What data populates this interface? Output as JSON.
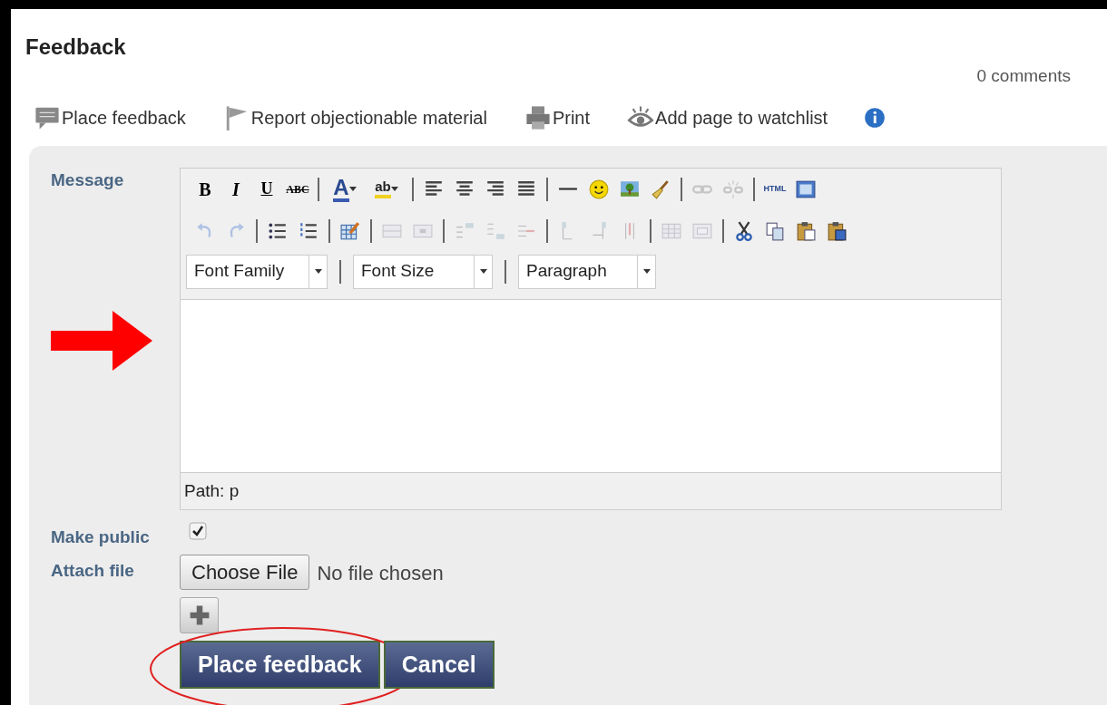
{
  "title": "Feedback",
  "comment_count": "0 comments",
  "actions": [
    {
      "kind": "speech",
      "label": "Place feedback"
    },
    {
      "kind": "flag",
      "label": "Report objectionable material"
    },
    {
      "kind": "printer",
      "label": "Print"
    },
    {
      "kind": "eye",
      "label": "Add page to watchlist"
    },
    {
      "kind": "info"
    }
  ],
  "form": {
    "message_label": "Message",
    "editor": {
      "toolbar_rows": [
        [
          {
            "kind": "bold",
            "label": "B",
            "disabled": false
          },
          {
            "kind": "italic",
            "label": "I",
            "disabled": false
          },
          {
            "kind": "underline",
            "label": "U",
            "disabled": false
          },
          {
            "kind": "strike",
            "label": "ABC",
            "disabled": false
          },
          {
            "kind": "separator"
          },
          {
            "kind": "forecolor",
            "label": "A",
            "disabled": false
          },
          {
            "kind": "backcolor",
            "label": "ab",
            "disabled": false
          },
          {
            "kind": "separator"
          },
          {
            "kind": "alignleft",
            "disabled": false
          },
          {
            "kind": "aligncenter",
            "disabled": false
          },
          {
            "kind": "alignright",
            "disabled": false
          },
          {
            "kind": "justify",
            "disabled": false
          },
          {
            "kind": "separator"
          },
          {
            "kind": "hr",
            "disabled": false
          },
          {
            "kind": "emoticon",
            "disabled": false
          },
          {
            "kind": "image",
            "disabled": false
          },
          {
            "kind": "cleanup",
            "disabled": false
          },
          {
            "kind": "separator"
          },
          {
            "kind": "link",
            "disabled": true
          },
          {
            "kind": "unlink",
            "disabled": true
          },
          {
            "kind": "separator"
          },
          {
            "kind": "html",
            "label": "HTML",
            "disabled": false
          },
          {
            "kind": "fullscreen",
            "disabled": false
          }
        ],
        [
          {
            "kind": "undo",
            "disabled": true
          },
          {
            "kind": "redo",
            "disabled": true
          },
          {
            "kind": "separator"
          },
          {
            "kind": "bullist",
            "disabled": false
          },
          {
            "kind": "numlist",
            "disabled": false
          },
          {
            "kind": "separator"
          },
          {
            "kind": "tableedit",
            "disabled": false
          },
          {
            "kind": "separator"
          },
          {
            "kind": "rowprops",
            "disabled": true
          },
          {
            "kind": "cellprops",
            "disabled": true
          },
          {
            "kind": "separator"
          },
          {
            "kind": "rowbefore",
            "disabled": true
          },
          {
            "kind": "rowafter",
            "disabled": true
          },
          {
            "kind": "deleterow",
            "disabled": true
          },
          {
            "kind": "separator"
          },
          {
            "kind": "colbefore",
            "disabled": true
          },
          {
            "kind": "colafter",
            "disabled": true
          },
          {
            "kind": "deletecol",
            "disabled": true
          },
          {
            "kind": "separator"
          },
          {
            "kind": "split",
            "disabled": true
          },
          {
            "kind": "merge",
            "disabled": true
          },
          {
            "kind": "separator"
          },
          {
            "kind": "cut",
            "disabled": false
          },
          {
            "kind": "copy",
            "disabled": false
          },
          {
            "kind": "paste",
            "disabled": false
          },
          {
            "kind": "pasteword",
            "disabled": false
          }
        ]
      ],
      "dropdowns": [
        {
          "value": "Font Family"
        },
        {
          "value": "Font Size"
        },
        {
          "value": "Paragraph"
        }
      ],
      "path": "Path: p"
    },
    "make_public": {
      "label": "Make public",
      "checked": true
    },
    "attach": {
      "label": "Attach file",
      "button": "Choose File",
      "status": "No file chosen"
    },
    "buttons": [
      {
        "label": "Place feedback",
        "highlighted": true
      },
      {
        "label": "Cancel",
        "highlighted": false
      }
    ]
  },
  "pointer_arrow": true
}
